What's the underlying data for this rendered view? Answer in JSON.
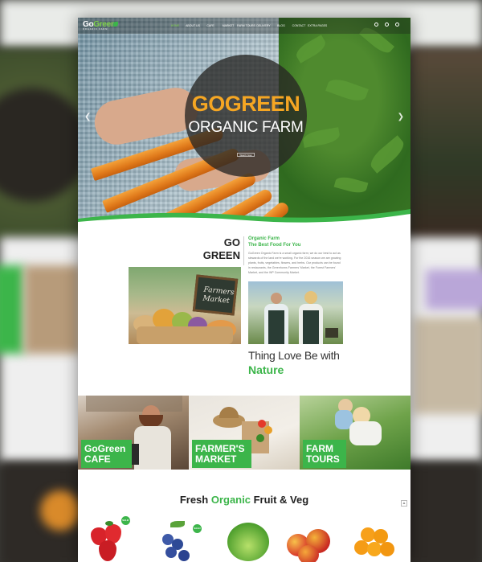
{
  "brand": {
    "logo_go": "Go",
    "logo_green": "Green",
    "tagline": "ORGANIC FARM"
  },
  "nav": {
    "items": [
      {
        "label": "HOME",
        "active": true
      },
      {
        "label": "ABOUT US",
        "active": false
      },
      {
        "label": "CAFE",
        "active": false
      },
      {
        "label": "MARKET",
        "active": false
      },
      {
        "label": "FARM TOURS",
        "active": false
      },
      {
        "label": "DELIVERY",
        "active": false
      },
      {
        "label": "BLOG",
        "active": false
      },
      {
        "label": "CONTACT",
        "active": false
      },
      {
        "label": "EXTRA PAGES",
        "active": false
      }
    ]
  },
  "hero": {
    "title": "GOGREEN",
    "subtitle": "ORGANIC FARM",
    "button_label": "Watch Now",
    "prev_icon": "chevron-left-icon",
    "next_icon": "chevron-right-icon"
  },
  "about": {
    "heading_line1": "GO",
    "heading_line2": "GREEN",
    "sub_line1": "Organic Farm",
    "sub_line2": "The Best Food For You",
    "body": "GoGreen Organic Farm is a small organic farm; we do our best to act as stewards of the land we're working. For the 2016 season we are growing plants, fruits, vegetables, flowers, and herbs. Our products can be found in restaurants, the Greenhorns Farmers' Market, the Forest Farmers' Market, and the WP Community Market.",
    "chalkboard_text_line1": "Farmers",
    "chalkboard_text_line2": "Market",
    "tagline_line1": "Thing Love Be with",
    "tagline_line2": "Nature"
  },
  "tiles": [
    {
      "line1": "GoGreen",
      "line2": "CAFE"
    },
    {
      "line1": "FARMER'S",
      "line2": "MARKET"
    },
    {
      "line1": "FARM",
      "line2": "TOURS"
    }
  ],
  "fresh": {
    "title_part1": "Fresh ",
    "title_part2": "Organic",
    "title_part3": " Fruit & Veg",
    "badge_label": "SALE!"
  },
  "colors": {
    "accent_green": "#3cb54a",
    "hero_orange": "#f5a623"
  }
}
